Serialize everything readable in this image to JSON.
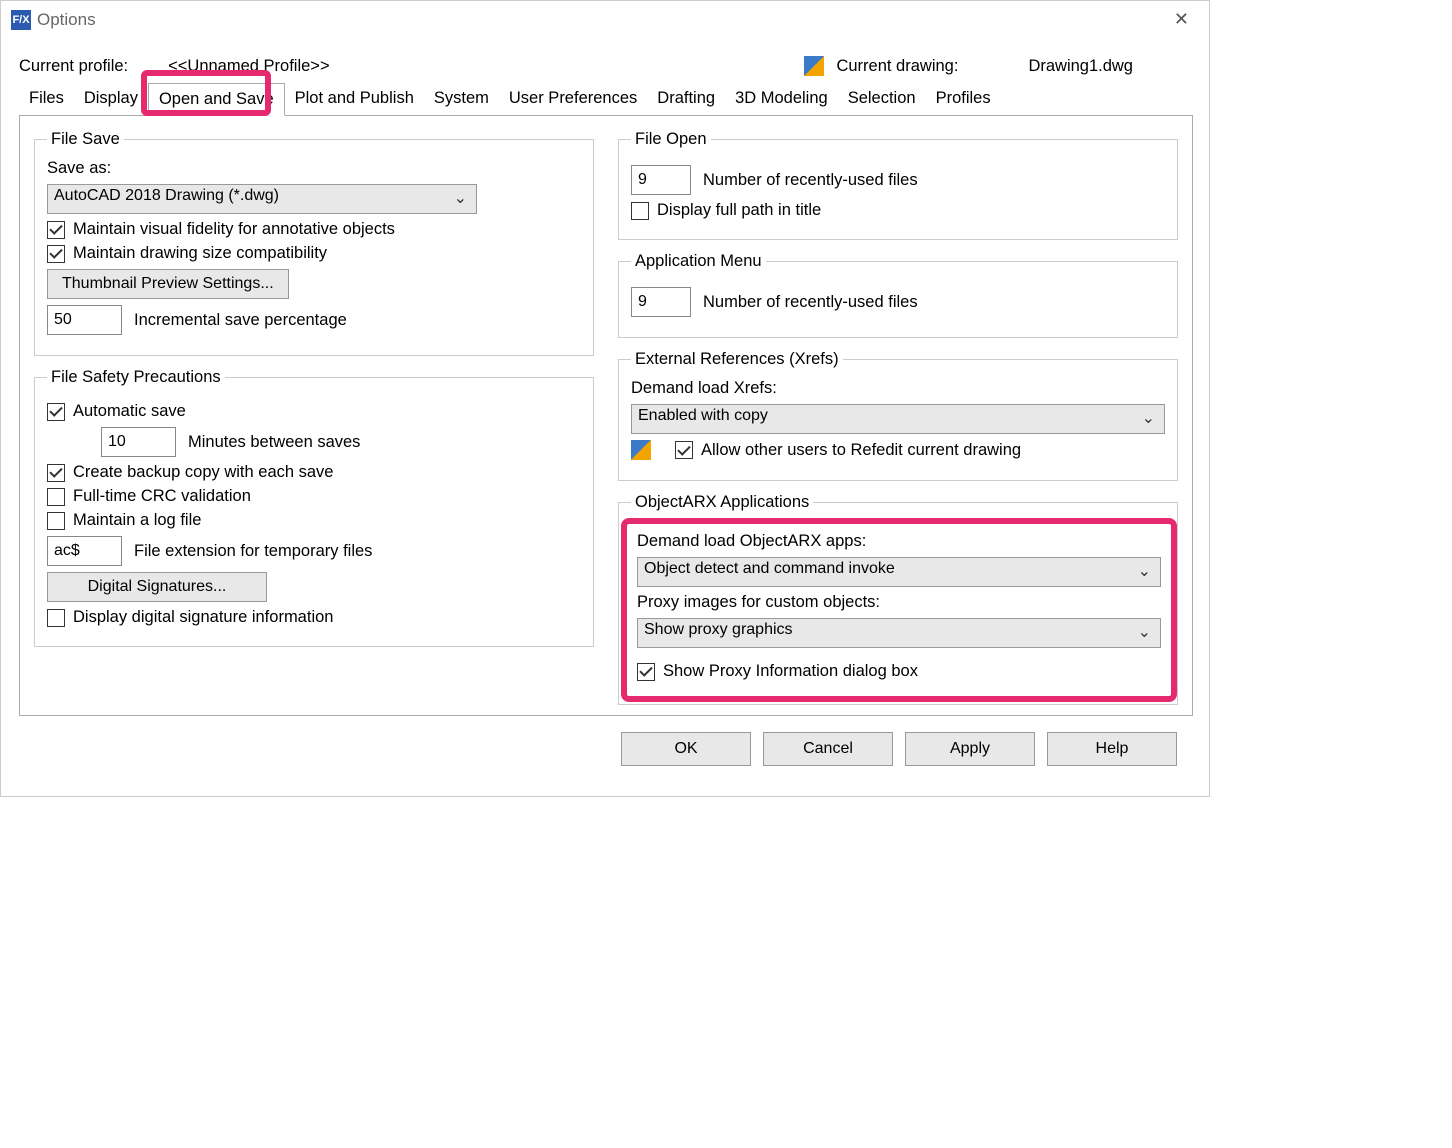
{
  "window": {
    "title": "Options"
  },
  "profile": {
    "label": "Current profile:",
    "value": "<<Unnamed Profile>>",
    "drawing_label": "Current drawing:",
    "drawing_value": "Drawing1.dwg"
  },
  "tabs": [
    "Files",
    "Display",
    "Open and Save",
    "Plot and Publish",
    "System",
    "User Preferences",
    "Drafting",
    "3D Modeling",
    "Selection",
    "Profiles"
  ],
  "active_tab": "Open and Save",
  "file_save": {
    "legend": "File Save",
    "save_as_label": "Save as:",
    "save_as_value": "AutoCAD 2018 Drawing (*.dwg)",
    "maintain_visual": "Maintain visual fidelity for annotative objects",
    "maintain_size": "Maintain drawing size compatibility",
    "thumb_btn": "Thumbnail Preview Settings...",
    "incr_val": "50",
    "incr_label": "Incremental save percentage"
  },
  "safety": {
    "legend": "File Safety Precautions",
    "auto_save": "Automatic save",
    "mins_val": "10",
    "mins_label": "Minutes between saves",
    "backup": "Create backup copy with each save",
    "crc": "Full-time CRC validation",
    "logfile": "Maintain a log file",
    "ext_val": "ac$",
    "ext_label": "File extension for temporary files",
    "sig_btn": "Digital Signatures...",
    "sig_info": "Display digital signature information"
  },
  "file_open": {
    "legend": "File Open",
    "recent_val": "9",
    "recent_label": "Number of recently-used files",
    "fullpath": "Display full path in title"
  },
  "app_menu": {
    "legend": "Application Menu",
    "recent_val": "9",
    "recent_label": "Number of recently-used files"
  },
  "xrefs": {
    "legend": "External References (Xrefs)",
    "demand_label": "Demand load Xrefs:",
    "demand_value": "Enabled with copy",
    "allow": "Allow other users to Refedit current drawing"
  },
  "arx": {
    "legend": "ObjectARX Applications",
    "demand_label": "Demand load ObjectARX apps:",
    "demand_value": "Object detect and command invoke",
    "proxy_label": "Proxy images for custom objects:",
    "proxy_value": "Show proxy graphics",
    "show_dialog": "Show Proxy Information dialog box"
  },
  "footer": {
    "ok": "OK",
    "cancel": "Cancel",
    "apply": "Apply",
    "help": "Help"
  }
}
